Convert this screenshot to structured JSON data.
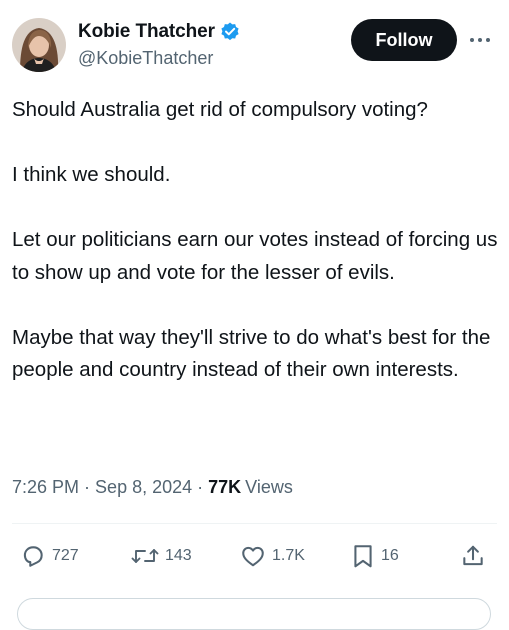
{
  "author": {
    "display_name": "Kobie Thatcher",
    "handle": "@KobieThatcher",
    "verified": true,
    "verified_color": "#1d9bf0"
  },
  "follow_label": "Follow",
  "tweet": {
    "paragraphs": [
      "Should Australia get rid of compulsory voting?",
      "I think we should.",
      "Let our politicians earn our votes instead of forcing us to show up and vote for the lesser of evils.",
      "Maybe that way they'll strive to do what's best for the people and country instead of their own interests."
    ]
  },
  "meta": {
    "time": "7:26 PM",
    "separator": "·",
    "date": "Sep 8, 2024",
    "views_count": "77K",
    "views_label": "Views"
  },
  "actions": {
    "replies": "727",
    "reposts": "143",
    "likes": "1.7K",
    "bookmarks": "16"
  },
  "icons": {
    "more": "more-icon",
    "reply": "reply-icon",
    "repost": "repost-icon",
    "like": "heart-icon",
    "bookmark": "bookmark-icon",
    "share": "share-icon"
  },
  "colors": {
    "text": "#0f1419",
    "secondary": "#536471",
    "follow_bg": "#0f1419",
    "divider": "#eff3f4"
  }
}
